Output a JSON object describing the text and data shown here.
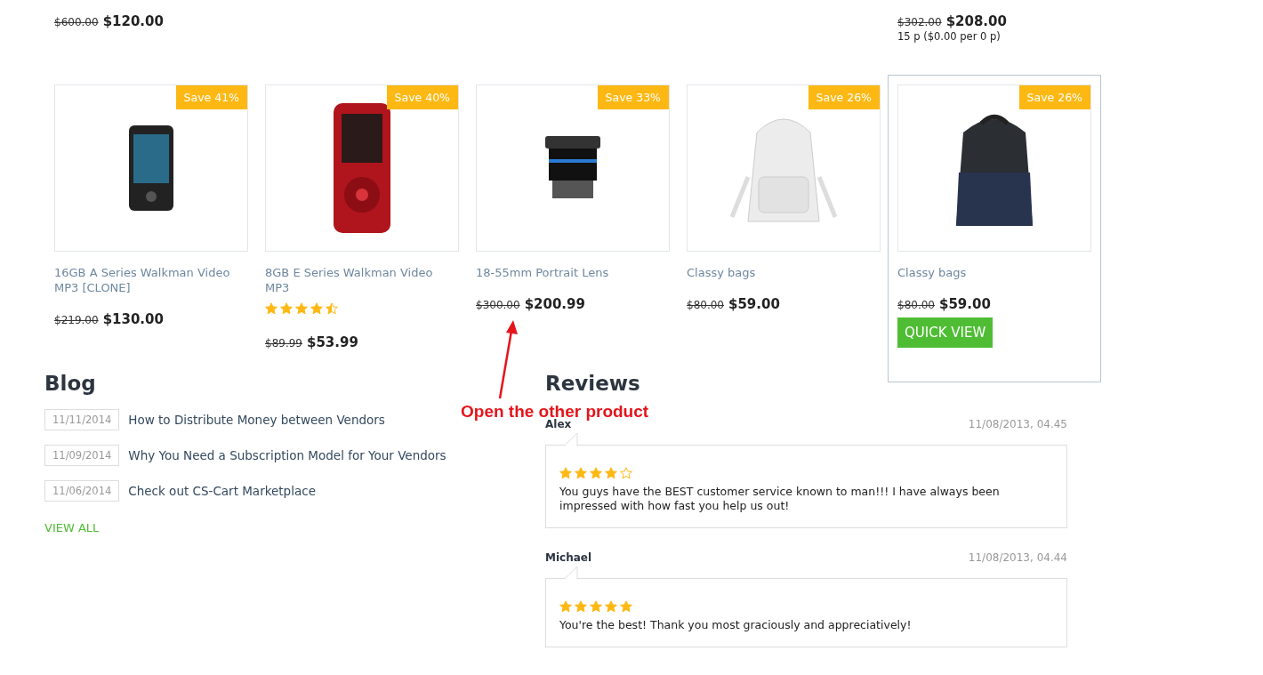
{
  "top_prices": [
    {
      "old": "$600.00",
      "price": "$120.00"
    },
    {
      "old": "$302.00",
      "price": "$208.00",
      "unit": "15 p ($0.00 per 0 p)"
    }
  ],
  "products": [
    {
      "kind": "player",
      "badge": "Save 41%",
      "name": "16GB A Series Walkman Video MP3 [CLONE]",
      "old": "$219.00",
      "price": "$130.00",
      "hovered": false
    },
    {
      "kind": "red-player",
      "badge": "Save 40%",
      "name": "8GB E Series Walkman Video MP3",
      "stars": 4.5,
      "old": "$89.99",
      "price": "$53.99",
      "hovered": false
    },
    {
      "kind": "lens",
      "badge": "Save 33%",
      "name": "18-55mm Portrait Lens",
      "old": "$300.00",
      "price": "$200.99",
      "hovered": false
    },
    {
      "kind": "white-bag",
      "badge": "Save 26%",
      "name": "Classy bags",
      "old": "$80.00",
      "price": "$59.00",
      "hovered": false
    },
    {
      "kind": "dark-bag",
      "badge": "Save 26%",
      "name": "Classy bags",
      "old": "$80.00",
      "price": "$59.00",
      "hovered": true,
      "quick_view": "QUICK VIEW"
    }
  ],
  "annotation": "Open the other product",
  "blog": {
    "title": "Blog",
    "posts": [
      {
        "date": "11/11/2014",
        "title": "How to Distribute Money between Vendors"
      },
      {
        "date": "11/09/2014",
        "title": "Why You Need a Subscription Model for Your Vendors"
      },
      {
        "date": "11/06/2014",
        "title": "Check out CS-Cart Marketplace"
      }
    ],
    "view_all": "VIEW ALL"
  },
  "reviews": {
    "title": "Reviews",
    "items": [
      {
        "author": "Alex",
        "date": "11/08/2013, 04.45",
        "stars": 4,
        "text": "You guys have the BEST customer service known to man!!! I have always been impressed with how fast you help us out!"
      },
      {
        "author": "Michael",
        "date": "11/08/2013, 04.44",
        "stars": 5,
        "text": "You're the best! Thank you most graciously and appreciatively!"
      }
    ]
  }
}
